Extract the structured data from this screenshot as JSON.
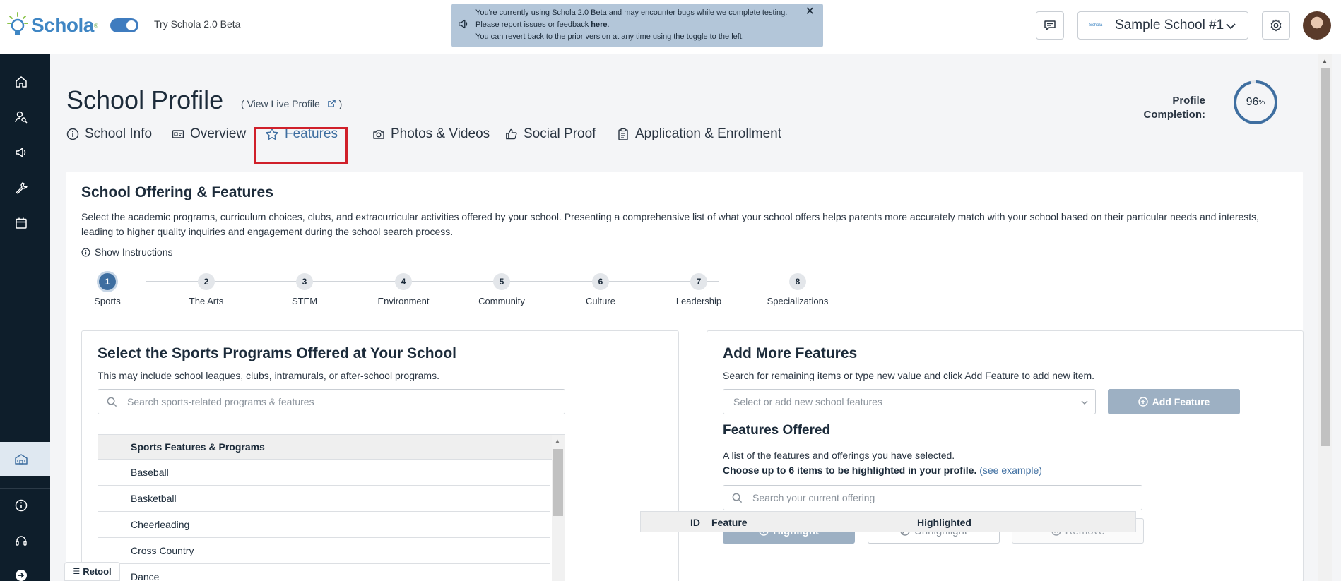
{
  "header": {
    "brand": "Schola",
    "beta_label": "Try Schola 2.0 Beta",
    "notice_lines": [
      "You're currently using Schola 2.0 Beta and may encounter bugs while we complete testing.",
      "You can revert back to the prior version at any time using the toggle to the left."
    ],
    "notice_line2_prefix": "Please report issues or feedback ",
    "notice_link": "here",
    "notice_line2_suffix": ".",
    "school_name": "Sample School #1",
    "school_mini_logo": "Schola",
    "accent_color": "#3f86c4"
  },
  "sidebar": {
    "items": [
      "home-icon",
      "user-search-icon",
      "megaphone-icon",
      "wrench-icon",
      "calendar-icon",
      "school-icon",
      "info-icon",
      "headset-icon",
      "arrow-right-icon"
    ],
    "active": "school-icon"
  },
  "page": {
    "title": "School Profile",
    "view_live_open": "(",
    "view_live_label": "View Live Profile",
    "view_live_close": ")",
    "completion_label": "Profile Completion:",
    "completion_value": "96",
    "completion_unit": "%",
    "completion_fraction": 0.96
  },
  "tabs": [
    {
      "label": "School Info",
      "icon": "info-icon"
    },
    {
      "label": "Overview",
      "icon": "id-card-icon"
    },
    {
      "label": "Features",
      "icon": "star-icon"
    },
    {
      "label": "Photos & Videos",
      "icon": "camera-icon"
    },
    {
      "label": "Social Proof",
      "icon": "thumbs-up-icon"
    },
    {
      "label": "Application & Enrollment",
      "icon": "clipboard-icon"
    }
  ],
  "active_tab": "Features",
  "section": {
    "title": "School Offering & Features",
    "description": "Select the academic programs, curriculum choices, clubs, and extracurricular activities offered by your school. Presenting a comprehensive list of what your school offers helps parents more accurately match with your school based on their particular needs and interests, leading to higher quality inquiries and engagement during the school search process.",
    "instructions": "Show Instructions"
  },
  "stepper": {
    "active": 1,
    "steps": [
      {
        "num": "1",
        "label": "Sports"
      },
      {
        "num": "2",
        "label": "The Arts"
      },
      {
        "num": "3",
        "label": "STEM"
      },
      {
        "num": "4",
        "label": "Environment"
      },
      {
        "num": "5",
        "label": "Community"
      },
      {
        "num": "6",
        "label": "Culture"
      },
      {
        "num": "7",
        "label": "Leadership"
      },
      {
        "num": "8",
        "label": "Specializations"
      }
    ]
  },
  "sports_panel": {
    "title": "Select the Sports Programs Offered at Your School",
    "description": "This may include school leagues, clubs, intramurals, or after-school programs.",
    "search_placeholder": "Search sports-related programs & features",
    "table_header": "Sports Features & Programs",
    "rows": [
      "Baseball",
      "Basketball",
      "Cheerleading",
      "Cross Country",
      "Dance"
    ]
  },
  "features_panel": {
    "title": "Add More Features",
    "description": "Search for remaining items or type new value and click Add Feature to add new item.",
    "select_placeholder": "Select or add new school features",
    "add_button": "Add Feature",
    "offered_title": "Features Offered",
    "offered_desc": "A list of the features and offerings you have selected.",
    "offered_choose": "Choose up to 6 items to be highlighted in your profile.",
    "example_link": "(see example)",
    "search_placeholder": "Search your current offering",
    "highlight_button": "Highlight",
    "unhighlight_button": "Unhighlight",
    "remove_button": "Remove",
    "table_columns": [
      "ID",
      "Feature",
      "Highlighted"
    ]
  },
  "footer": {
    "retool_label": "Retool"
  }
}
